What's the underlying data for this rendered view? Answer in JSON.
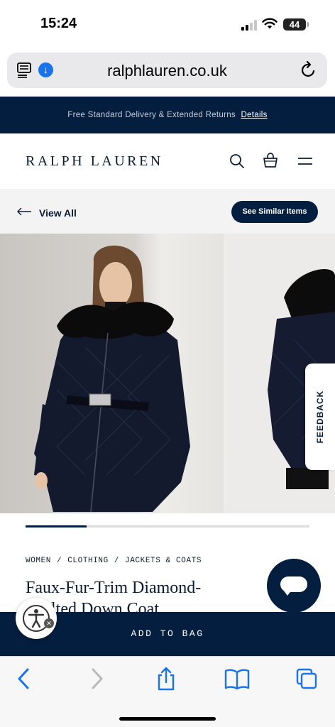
{
  "status_bar": {
    "time": "15:24",
    "battery": "44"
  },
  "browser": {
    "url": "ralphlauren.co.uk"
  },
  "promo": {
    "text": "Free Standard Delivery & Extended Returns",
    "link": "Details"
  },
  "header": {
    "logo": "RALPH LAUREN"
  },
  "subnav": {
    "view_all": "View All",
    "similar": "See Similar Items"
  },
  "carousel": {
    "progress": 0.215
  },
  "feedback": {
    "label": "FEEDBACK"
  },
  "breadcrumb": {
    "items": [
      "WOMEN",
      "CLOTHING",
      "JACKETS & COATS"
    ],
    "separator": "/"
  },
  "product": {
    "title": "Faux-Fur-Trim Diamond-Quilted Down Coat"
  },
  "cta": {
    "add_to_bag": "ADD TO BAG"
  },
  "colors": {
    "navy": "#041e3f",
    "accent_blue": "#1a73e8"
  },
  "icons": [
    "reader-icon",
    "download-icon",
    "reload-icon",
    "search-icon",
    "bag-icon",
    "menu-icon",
    "arrow-left-icon",
    "chat-icon",
    "accessibility-icon",
    "back-icon",
    "forward-icon",
    "share-icon",
    "bookmarks-icon",
    "tabs-icon"
  ]
}
